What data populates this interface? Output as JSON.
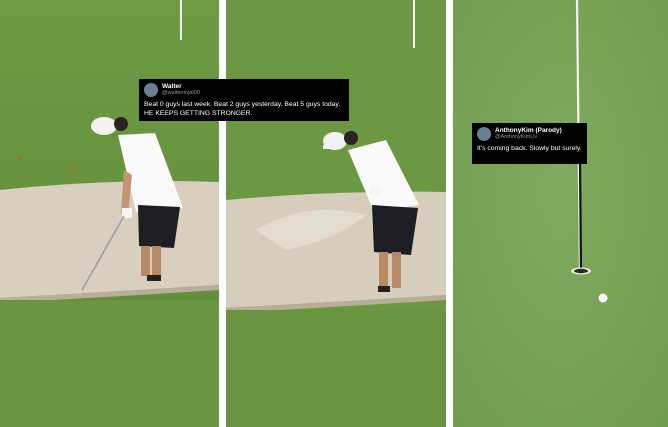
{
  "tweets": [
    {
      "display_name": "Walter",
      "handle": "@waltterinjat00",
      "text": "Beat 0 guys last week. Beat 2 guys yesterday. Beat 5 guys today. HE KEEPS GETTING STRONGER."
    },
    {
      "display_name": "AnthonyKim (Parody)",
      "handle": "@AnthonyKimLiv",
      "text": "It's coming back. Slowly but surely."
    }
  ],
  "colors": {
    "grass": "#6f9a45",
    "grass_dark": "#5d8a38",
    "sand": "#d9d0c1",
    "green_putting": "#7aa65a",
    "tweet_bg": "#000000",
    "shirt": "#ffffff",
    "shorts": "#1b1d22"
  }
}
